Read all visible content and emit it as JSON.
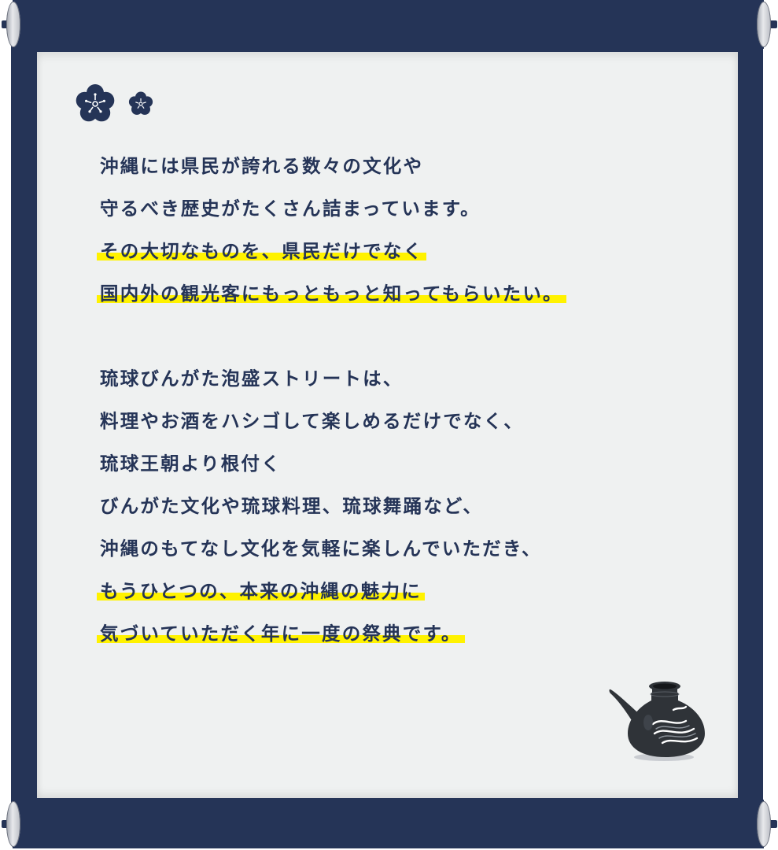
{
  "paragraph_1": [
    {
      "text": "沖縄には県民が誇れる数々の文化や",
      "highlight": false
    },
    {
      "text": "守るべき歴史がたくさん詰まっています。",
      "highlight": false
    },
    {
      "text": "その大切なものを、県民だけでなく",
      "highlight": true
    },
    {
      "text": "国内外の観光客にもっともっと知ってもらいたい。",
      "highlight": true
    }
  ],
  "paragraph_2": [
    {
      "text": "琉球びんがた泡盛ストリートは、",
      "highlight": false
    },
    {
      "text": "料理やお酒をハシゴして楽しめるだけでなく、",
      "highlight": false
    },
    {
      "text": "琉球王朝より根付く",
      "highlight": false
    },
    {
      "text": "びんがた文化や琉球料理、琉球舞踊など、",
      "highlight": false
    },
    {
      "text": "沖縄のもてなし文化を気軽に楽しんでいただき、",
      "highlight": false
    },
    {
      "text": "もうひとつの、本来の沖縄の魅力に",
      "highlight": true
    },
    {
      "text": "気づいていただく年に一度の祭典です。",
      "highlight": true
    }
  ],
  "colors": {
    "navy": "#253457",
    "paper": "#eff1f1",
    "highlight": "#fff200",
    "text": "#253457"
  },
  "icons": [
    "flower-large-icon",
    "flower-small-icon",
    "awamori-pot-icon"
  ]
}
